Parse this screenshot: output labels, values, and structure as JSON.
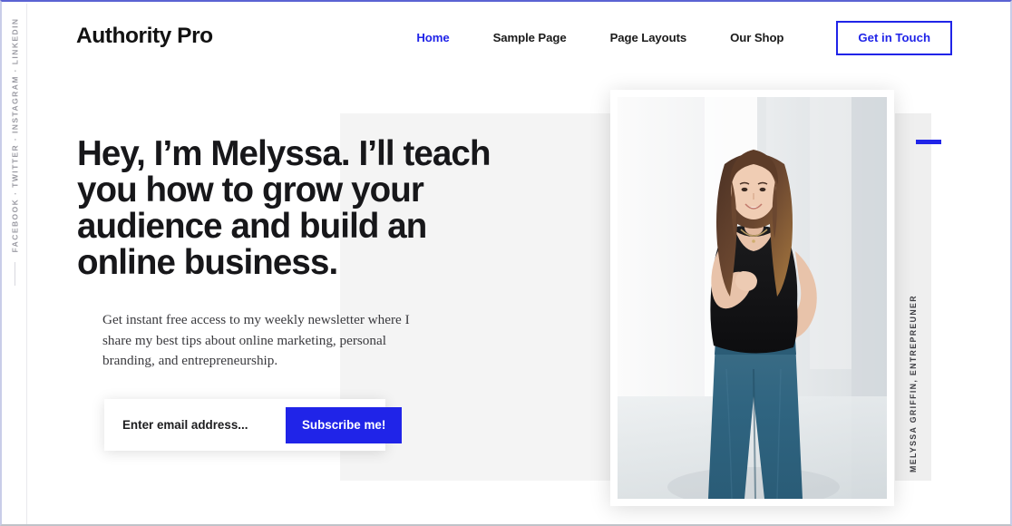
{
  "theme": {
    "accent_blue": "#2024e8",
    "text_dark": "#17171a",
    "gray_block": "#f4f4f4",
    "gray_block_right": "#efefef",
    "rail_text": "#9b9ba3"
  },
  "header": {
    "logo": "Authority Pro",
    "nav": [
      {
        "label": "Home",
        "active": true
      },
      {
        "label": "Sample Page",
        "active": false
      },
      {
        "label": "Page Layouts",
        "active": false
      },
      {
        "label": "Our Shop",
        "active": false
      }
    ],
    "cta_label": "Get in Touch"
  },
  "social_rail": {
    "text": "FACEBOOK  ·  TWITTER  ·  INSTAGRAM  ·  LINKEDIN",
    "networks": [
      "FACEBOOK",
      "TWITTER",
      "INSTAGRAM",
      "LINKEDIN"
    ]
  },
  "hero": {
    "headline": "Hey, I’m Melyssa. I’ll teach you how to grow your audience and build an online business.",
    "subtext": "Get instant free access to my weekly newsletter where I share my best tips about online marketing, personal branding, and entrepreneurship.",
    "form": {
      "email_placeholder": "Enter email address...",
      "email_value": "",
      "submit_label": "Subscribe me!"
    },
    "portrait_caption": "MELYSSA GRIFFIN, ENTREPREUNER",
    "portrait_alt": "woman-portrait-photo"
  }
}
